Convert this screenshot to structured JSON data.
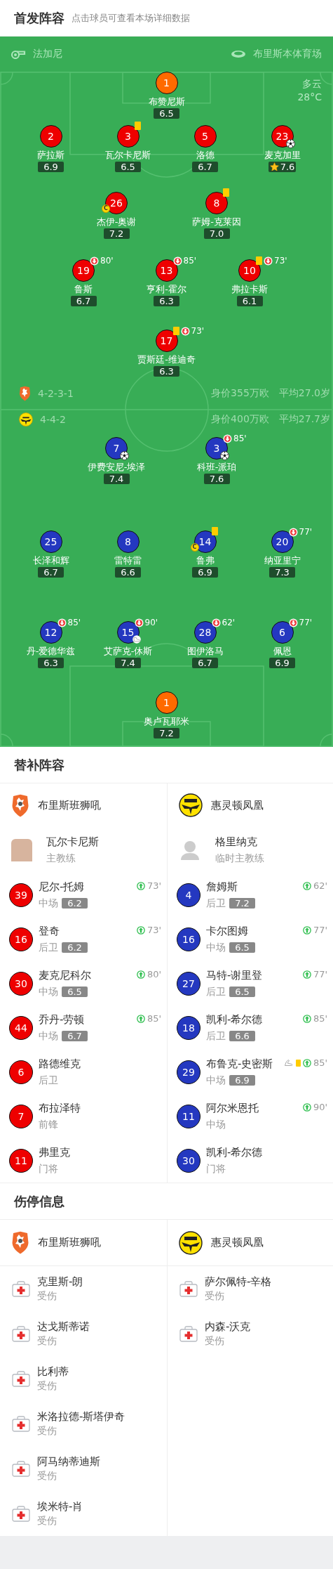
{
  "lineup": {
    "title": "首发阵容",
    "hint": "点击球员可查看本场详细数据",
    "referee": "法加尼",
    "venue": "布里斯本体育场",
    "weather": "多云",
    "temperature": "28°C",
    "home": {
      "formation": "4-2-3-1",
      "value": "身价355万欧",
      "avg_age": "平均27.0岁",
      "rows": [
        {
          "players": [
            {
              "number": "1",
              "name": "布赞尼斯",
              "rating": "6.5",
              "color": "#ff6a00",
              "best": false
            }
          ]
        },
        {
          "players": [
            {
              "number": "2",
              "name": "萨拉斯",
              "rating": "6.9",
              "color": "#ee0000",
              "best": false
            },
            {
              "number": "3",
              "name": "瓦尔卡尼斯",
              "rating": "6.5",
              "color": "#ee0000",
              "best": false,
              "events": [
                {
                  "kind": "yellow_card"
                }
              ]
            },
            {
              "number": "5",
              "name": "洛德",
              "rating": "6.7",
              "color": "#ee0000",
              "best": false
            },
            {
              "number": "23",
              "name": "麦克加里",
              "rating": "7.6",
              "color": "#ee0000",
              "best": true,
              "events": [
                {
                  "kind": "goal"
                }
              ]
            }
          ]
        },
        {
          "players": [
            {
              "number": "26",
              "name": "杰伊-奥谢",
              "rating": "7.2",
              "color": "#ee0000",
              "best": false,
              "events": [
                {
                  "kind": "captain",
                  "label": "C"
                }
              ]
            },
            {
              "number": "8",
              "name": "萨姆-克莱因",
              "rating": "7.0",
              "color": "#ee0000",
              "best": false,
              "events": [
                {
                  "kind": "yellow_card"
                }
              ]
            }
          ]
        },
        {
          "players": [
            {
              "number": "19",
              "name": "鲁斯",
              "rating": "6.7",
              "color": "#ee0000",
              "best": false,
              "events": [
                {
                  "kind": "sub_off",
                  "minute": "80'"
                }
              ]
            },
            {
              "number": "13",
              "name": "亨利-霍尔",
              "rating": "6.3",
              "color": "#ee0000",
              "best": false,
              "events": [
                {
                  "kind": "sub_off",
                  "minute": "85'"
                }
              ]
            },
            {
              "number": "10",
              "name": "弗拉卡斯",
              "rating": "6.1",
              "color": "#ee0000",
              "best": false,
              "events": [
                {
                  "kind": "yellow_card"
                },
                {
                  "kind": "sub_off",
                  "minute": "73'"
                }
              ]
            }
          ]
        },
        {
          "players": [
            {
              "number": "17",
              "name": "贾斯廷-维迪奇",
              "rating": "6.3",
              "color": "#ee0000",
              "best": false,
              "events": [
                {
                  "kind": "yellow_card"
                },
                {
                  "kind": "sub_off",
                  "minute": "73'"
                }
              ]
            }
          ]
        }
      ]
    },
    "away": {
      "formation": "4-4-2",
      "value": "身价400万欧",
      "avg_age": "平均27.7岁",
      "rows": [
        {
          "players": [
            {
              "number": "7",
              "name": "伊费安尼-埃泽",
              "rating": "7.4",
              "color": "#2438c0",
              "best": false,
              "events": [
                {
                  "kind": "goal"
                }
              ]
            },
            {
              "number": "3",
              "name": "科班-派珀",
              "rating": "7.6",
              "color": "#2438c0",
              "best": false,
              "events": [
                {
                  "kind": "sub_off",
                  "minute": "85'"
                },
                {
                  "kind": "goal"
                }
              ]
            }
          ]
        },
        {
          "players": [
            {
              "number": "25",
              "name": "长泽和辉",
              "rating": "6.7",
              "color": "#2438c0",
              "best": false
            },
            {
              "number": "8",
              "name": "雷特雷",
              "rating": "6.6",
              "color": "#2438c0",
              "best": false
            },
            {
              "number": "14",
              "name": "鲁弗",
              "rating": "6.9",
              "color": "#2438c0",
              "best": false,
              "events": [
                {
                  "kind": "yellow_card"
                },
                {
                  "kind": "captain",
                  "label": "C"
                }
              ]
            },
            {
              "number": "20",
              "name": "纳亚里宁",
              "rating": "7.3",
              "color": "#2438c0",
              "best": false,
              "events": [
                {
                  "kind": "sub_off",
                  "minute": "77'"
                }
              ]
            }
          ]
        },
        {
          "players": [
            {
              "number": "12",
              "name": "丹-爱德华兹",
              "rating": "6.3",
              "color": "#2438c0",
              "best": false,
              "events": [
                {
                  "kind": "sub_off",
                  "minute": "85'"
                }
              ]
            },
            {
              "number": "15",
              "name": "艾萨克-休斯",
              "rating": "7.4",
              "color": "#2438c0",
              "best": false,
              "events": [
                {
                  "kind": "sub_off",
                  "minute": "90'"
                },
                {
                  "kind": "assist"
                }
              ]
            },
            {
              "number": "28",
              "name": "图伊洛马",
              "rating": "6.7",
              "color": "#2438c0",
              "best": false,
              "events": [
                {
                  "kind": "sub_off",
                  "minute": "62'"
                }
              ]
            },
            {
              "number": "6",
              "name": "佩恩",
              "rating": "6.9",
              "color": "#2438c0",
              "best": false,
              "events": [
                {
                  "kind": "sub_off",
                  "minute": "77'"
                }
              ]
            }
          ]
        },
        {
          "players": [
            {
              "number": "1",
              "name": "奥卢瓦耶米",
              "rating": "7.2",
              "color": "#ff6a00",
              "best": false
            }
          ]
        }
      ]
    }
  },
  "substitutes": {
    "title": "替补阵容",
    "teams": [
      {
        "name": "布里斯班狮吼",
        "coach": {
          "name": "瓦尔卡尼斯",
          "role": "主教练",
          "kind": "photo"
        },
        "players": [
          {
            "number": "39",
            "name": "尼尔-托姆",
            "position": "中场",
            "rating": "6.2",
            "color": "#ee0000",
            "events": [
              {
                "kind": "sub_on",
                "minute": "73'"
              }
            ]
          },
          {
            "number": "16",
            "name": "登奇",
            "position": "后卫",
            "rating": "6.2",
            "color": "#ee0000",
            "events": [
              {
                "kind": "sub_on",
                "minute": "73'"
              }
            ]
          },
          {
            "number": "30",
            "name": "麦克尼科尔",
            "position": "中场",
            "rating": "6.5",
            "color": "#ee0000",
            "events": [
              {
                "kind": "sub_on",
                "minute": "80'"
              }
            ]
          },
          {
            "number": "44",
            "name": "乔丹-劳顿",
            "position": "中场",
            "rating": "6.7",
            "color": "#ee0000",
            "events": [
              {
                "kind": "sub_on",
                "minute": "85'"
              }
            ]
          },
          {
            "number": "6",
            "name": "路德维克",
            "position": "后卫",
            "color": "#ee0000"
          },
          {
            "number": "7",
            "name": "布拉泽特",
            "position": "前锋",
            "color": "#ee0000"
          },
          {
            "number": "11",
            "name": "弗里克",
            "position": "门将",
            "color": "#ee0000"
          }
        ]
      },
      {
        "name": "惠灵顿凤凰",
        "coach": {
          "name": "格里纳克",
          "role": "临时主教练",
          "kind": "placeholder"
        },
        "players": [
          {
            "number": "4",
            "name": "詹姆斯",
            "position": "后卫",
            "rating": "7.2",
            "color": "#2438c0",
            "events": [
              {
                "kind": "sub_on",
                "minute": "62'"
              }
            ]
          },
          {
            "number": "16",
            "name": "卡尔图姆",
            "position": "中场",
            "rating": "6.5",
            "color": "#2438c0",
            "events": [
              {
                "kind": "sub_on",
                "minute": "77'"
              }
            ]
          },
          {
            "number": "27",
            "name": "马特-谢里登",
            "position": "后卫",
            "rating": "6.5",
            "color": "#2438c0",
            "events": [
              {
                "kind": "sub_on",
                "minute": "77'"
              }
            ]
          },
          {
            "number": "18",
            "name": "凯利-希尔德",
            "position": "后卫",
            "rating": "6.6",
            "color": "#2438c0",
            "events": [
              {
                "kind": "sub_on",
                "minute": "85'"
              }
            ]
          },
          {
            "number": "29",
            "name": "布鲁克-史密斯",
            "position": "中场",
            "rating": "6.9",
            "color": "#2438c0",
            "events": [
              {
                "kind": "assist"
              },
              {
                "kind": "yellow_card"
              },
              {
                "kind": "sub_on",
                "minute": "85'"
              }
            ]
          },
          {
            "number": "11",
            "name": "阿尔米恩托",
            "position": "中场",
            "color": "#2438c0",
            "events": [
              {
                "kind": "sub_on",
                "minute": "90'"
              }
            ]
          },
          {
            "number": "30",
            "name": "凯利-希尔德",
            "position": "门将",
            "color": "#2438c0"
          }
        ]
      }
    ]
  },
  "injuries": {
    "title": "伤停信息",
    "teams": [
      {
        "name": "布里斯班狮吼",
        "players": [
          {
            "name": "克里斯-朗",
            "status": "受伤"
          },
          {
            "name": "达戈斯蒂诺",
            "status": "受伤"
          },
          {
            "name": "比利蒂",
            "status": "受伤"
          },
          {
            "name": "米洛拉德-斯塔伊奇",
            "status": "受伤"
          },
          {
            "name": "阿马纳蒂迪斯",
            "status": "受伤"
          },
          {
            "name": "埃米特-肖",
            "status": "受伤"
          }
        ]
      },
      {
        "name": "惠灵顿凤凰",
        "players": [
          {
            "name": "萨尔佩特-辛格",
            "status": "受伤"
          },
          {
            "name": "内森-沃克",
            "status": "受伤"
          }
        ]
      }
    ]
  }
}
